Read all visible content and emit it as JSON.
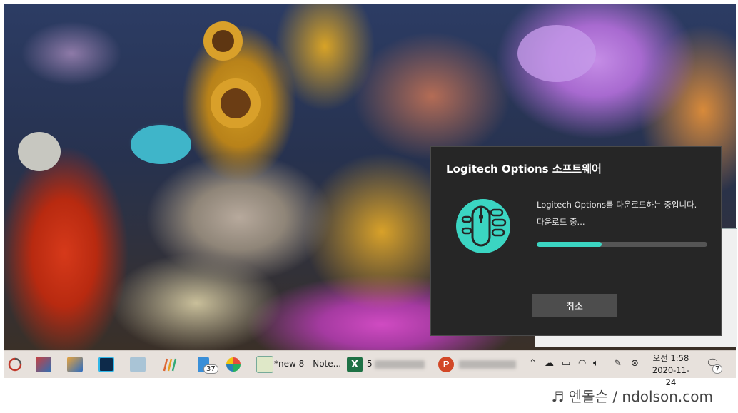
{
  "dialog": {
    "title": "Logitech Options 소프트웨어",
    "message": "Logitech Options를 다운로드하는 중입니다.",
    "status": "다운로드 중...",
    "progress": 0.38,
    "cancel_label": "취소",
    "accent": "#3bd5c2",
    "logo_icon": "logitech-options-mouse-logo"
  },
  "taskbar": {
    "items": [
      {
        "name": "app-icon-refresh"
      },
      {
        "name": "app-icon-1"
      },
      {
        "name": "app-icon-2"
      },
      {
        "name": "app-icon-3"
      },
      {
        "name": "app-icon-4"
      },
      {
        "name": "app-icon-5"
      },
      {
        "name": "app-icon-phone",
        "badge": "37"
      },
      {
        "name": "app-icon-pinwheel"
      },
      {
        "name": "notepad-plus-plus",
        "label": "*new 8 - Note..."
      },
      {
        "name": "excel",
        "label": "5"
      },
      {
        "name": "powerpoint"
      }
    ],
    "clock": {
      "time": "오전 1:58",
      "date": "2020-11-24"
    },
    "notification_count": "7"
  },
  "watermark": "♬ 엔돌슨 / ndolson.com"
}
